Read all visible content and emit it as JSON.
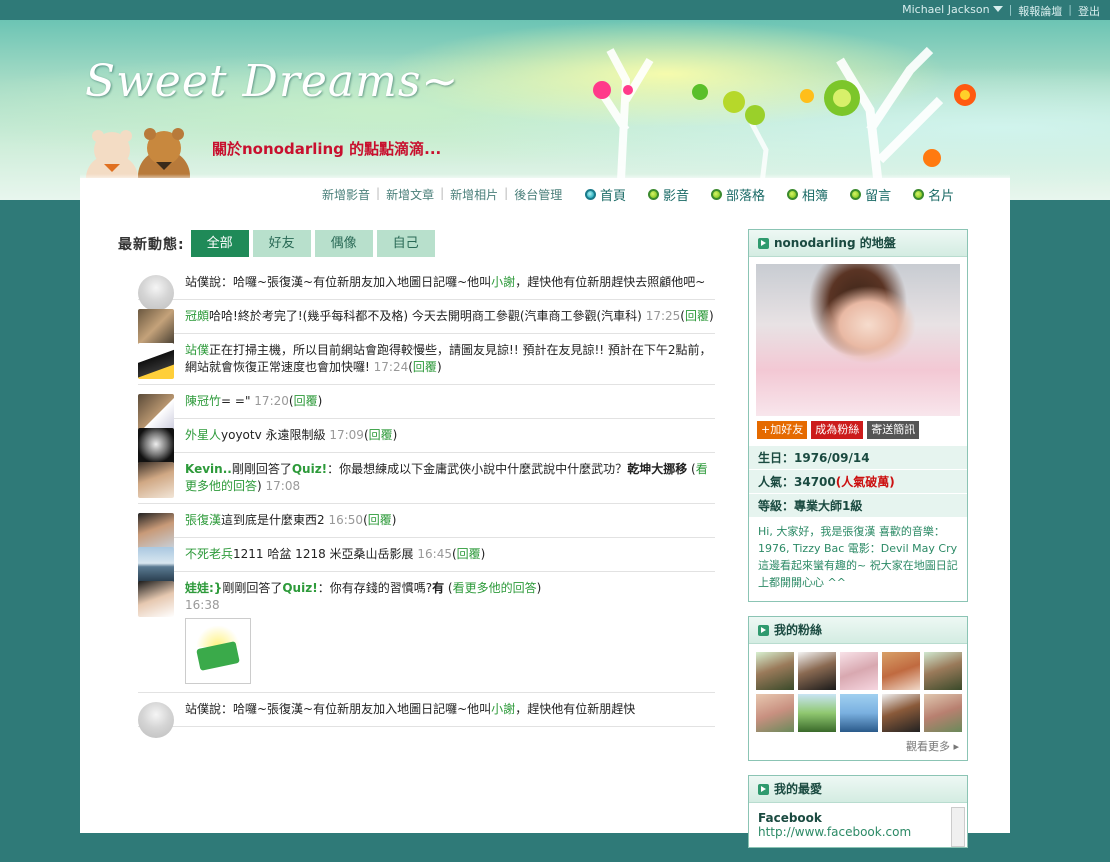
{
  "topbar": {
    "user": "Michael Jackson",
    "forum": "報報論壇",
    "logout": "登出"
  },
  "header": {
    "logo": "Sweet Dreams~",
    "subtitle": "關於nonodarling 的點點滴滴..."
  },
  "subnav": [
    "新增影音",
    "新增文章",
    "新增相片",
    "後台管理"
  ],
  "mainnav": [
    "首頁",
    "影音",
    "部落格",
    "相簿",
    "留言",
    "名片"
  ],
  "feed": {
    "title": "最新動態:",
    "tabs": [
      "全部",
      "好友",
      "偶像",
      "自己"
    ],
    "entries": [
      {
        "a": "",
        "b": "站僕說：哈囉~張復漢~有位新朋友加入地圖日記囉~他叫",
        "c": "小謝",
        "d": "，趕快他有位新朋趕快去照顧他吧~",
        "time": "",
        "reply": ""
      },
      {
        "a": "冠頗",
        "b": "哈哈!終於考完了!(幾乎每科都不及格) 今天去開明商工參觀(汽車商工參觀(汽車科)",
        "time": "17:25",
        "reply": "回覆"
      },
      {
        "a": "站僕",
        "b": "正在打掃主機，所以目前網站會跑得較慢些，請圖友見諒!! 預計在友見諒!! 預計在下午2點前，網站就會恢復正常速度也會加快囉!",
        "time": "17:24",
        "reply": "回覆"
      },
      {
        "a": "陳冠竹",
        "b": "= =\"",
        "time": "17:20",
        "reply": "回覆"
      },
      {
        "a": "外星人",
        "b": "yoyotv 永遠限制級",
        "time": "17:09",
        "reply": "回覆"
      },
      {
        "a": "Kevin..",
        "b": "剛剛回答了",
        "quiz": "Quiz!",
        "c": "：你最想練成以下金庸武俠小說中什麼武說中什麼武功？",
        "d": "乾坤大挪移",
        "more": "看更多他的回答",
        "time": "17:08"
      },
      {
        "a": "張復漢",
        "b": "這到底是什麼東西2",
        "time": "16:50",
        "reply": "回覆"
      },
      {
        "a": "不死老兵",
        "b": "1211 哈盆  1218 米亞桑山岳影展",
        "time": "16:45",
        "reply": "回覆"
      },
      {
        "a": "娃娃:}",
        "b": "剛剛回答了",
        "quiz": "Quiz!",
        "c": "：你有存錢的習慣嗎?",
        "d": "有",
        "more": "看更多他的回答",
        "time": "16:38"
      },
      {
        "a": "",
        "b": "站僕說：哈囉~張復漢~有位新朋友加入地圖日記囉~他叫",
        "c": "小謝",
        "d": "，趕快他有位新朋趕快",
        "time": "",
        "reply": ""
      }
    ]
  },
  "profile": {
    "title": "nonodarling 的地盤",
    "buttons": [
      "+加好友",
      "成為粉絲",
      "寄送簡訊"
    ],
    "birthday": "生日：1976/09/14",
    "popularity_label": "人氣：34700",
    "popularity_hot": "(人氣破萬)",
    "level": "等級：專業大師1級",
    "intro": "Hi, 大家好，我是張復漢 喜歡的音樂：1976, Tizzy Bac 電影：Devil May Cry 這邊看起來蠻有趣的~ 祝大家在地圖日記上都開開心心 ^^"
  },
  "fans": {
    "title": "我的粉絲",
    "more": "觀看更多 ▸"
  },
  "favorites": {
    "title": "我的最愛",
    "name": "Facebook",
    "url": "http://www.facebook.com"
  },
  "colors": {
    "accent": "#1f8a58",
    "link": "#2d9a3a",
    "hot": "#cc1010",
    "topbar": "#2f7a78"
  }
}
